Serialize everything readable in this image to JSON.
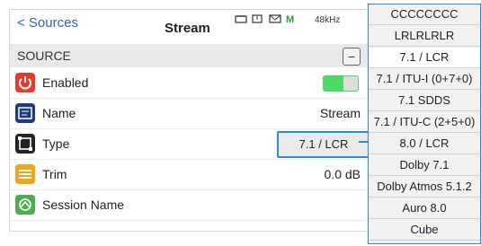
{
  "header": {
    "back_label": "< Sources",
    "title": "Stream",
    "sample_rate": "48kHz",
    "status_m": "M"
  },
  "section": {
    "label": "SOURCE",
    "collapse_label": "−"
  },
  "rows": {
    "enabled": {
      "label": "Enabled",
      "state": "on"
    },
    "name": {
      "label": "Name",
      "value": "Stream"
    },
    "type": {
      "label": "Type",
      "value": "7.1 / LCR"
    },
    "trim": {
      "label": "Trim",
      "value": "0.0 dB"
    },
    "session": {
      "label": "Session Name"
    }
  },
  "dropdown": {
    "options": [
      "CCCCCCCC",
      "LRLRLRLR",
      "7.1 / LCR",
      "7.1 / ITU-I (0+7+0)",
      "7.1 SDDS",
      "7.1 / ITU-C (2+5+0)",
      "8.0 / LCR",
      "Dolby 7.1",
      "Dolby Atmos 5.1.2",
      "Auro 8.0",
      "Cube"
    ],
    "selected_index": 2
  },
  "colors": {
    "accent": "#2a8bd6",
    "back_link": "#2a62c8",
    "toggle_on": "#4cd964"
  },
  "icons": [
    "power-icon",
    "name-icon",
    "type-icon",
    "trim-icon",
    "session-icon"
  ]
}
